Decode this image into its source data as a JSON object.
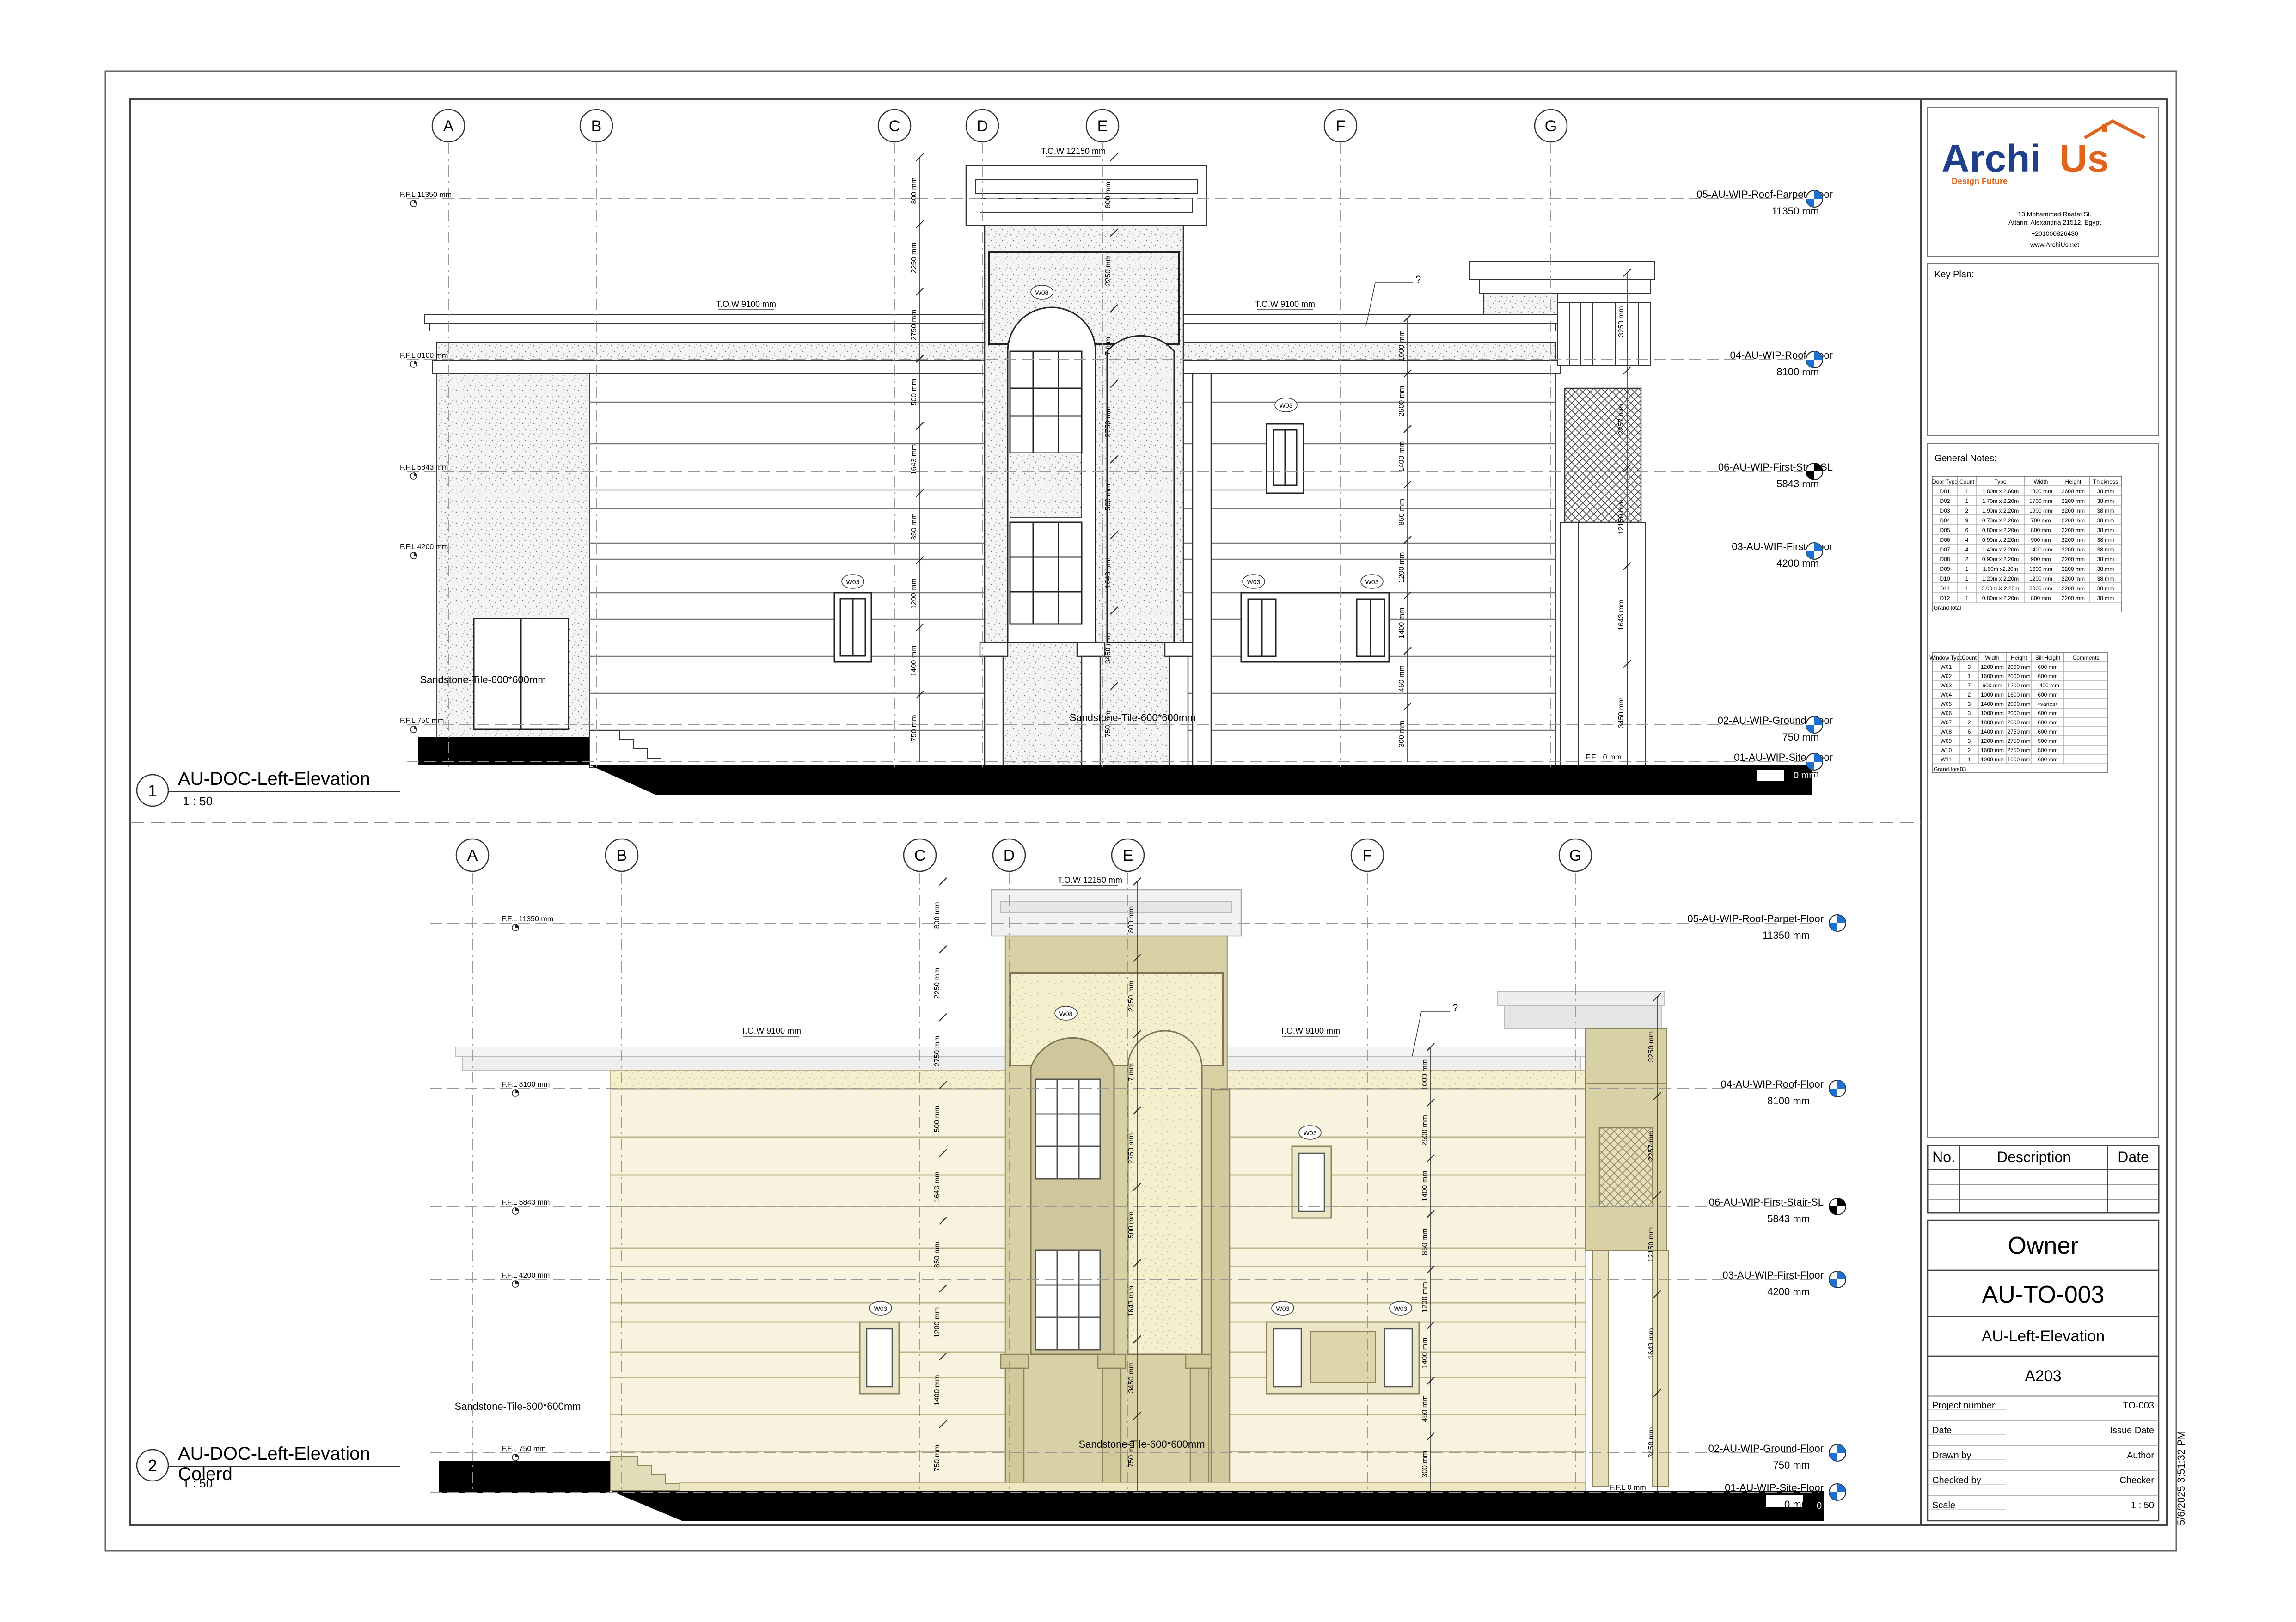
{
  "company": {
    "name_main": "Archi",
    "name_accent": "Us",
    "tagline": "Design Future",
    "address": [
      "13 Mohammad Raafat St.",
      "Attarin, Alexandria 21512, Egypt",
      "+201000826430",
      "www.ArchiUs.net"
    ]
  },
  "key_plan_label": "Key Plan:",
  "general_notes_label": "General Notes:",
  "door_schedule": {
    "headers": [
      "Door Type",
      "Count",
      "Type",
      "Width",
      "Height",
      "Thickness"
    ],
    "rows": [
      [
        "D01",
        "1",
        "1.80m x 2.60m",
        "1800 mm",
        "2600 mm",
        "38 mm"
      ],
      [
        "D02",
        "1",
        "1.70m x 2.20m",
        "1700 mm",
        "2200 mm",
        "38 mm"
      ],
      [
        "D03",
        "2",
        "1.90m x 2.20m",
        "1900 mm",
        "2200 mm",
        "38 mm"
      ],
      [
        "D04",
        "9",
        "0.70m x 2.20m",
        "700 mm",
        "2200 mm",
        "38 mm"
      ],
      [
        "D05",
        "6",
        "0.80m x 2.20m",
        "800 mm",
        "2200 mm",
        "38 mm"
      ],
      [
        "D06",
        "4",
        "0.90m x 2.20m",
        "900 mm",
        "2200 mm",
        "38 mm"
      ],
      [
        "D07",
        "4",
        "1.40m x 2.20m",
        "1400 mm",
        "2200 mm",
        "38 mm"
      ],
      [
        "D08",
        "2",
        "0.90m x 2.20m",
        "900 mm",
        "2200 mm",
        "38 mm"
      ],
      [
        "D09",
        "1",
        "1.60m x2.20m",
        "1600 mm",
        "2200 mm",
        "38 mm"
      ],
      [
        "D10",
        "1",
        "1.20m x 2.20m",
        "1200 mm",
        "2200 mm",
        "38 mm"
      ],
      [
        "D11",
        "1",
        "3.00m X 2.20m",
        "3000 mm",
        "2200 mm",
        "38 mm"
      ],
      [
        "D12",
        "1",
        "0.80m x 2.20m",
        "800 mm",
        "2200 mm",
        "38 mm"
      ]
    ],
    "footer": "Grand total"
  },
  "window_schedule": {
    "headers": [
      "Window Type",
      "Count",
      "Width",
      "Height",
      "Sill Height",
      "Comments"
    ],
    "rows": [
      [
        "W01",
        "3",
        "1200 mm",
        "2000 mm",
        "600 mm",
        ""
      ],
      [
        "W02",
        "1",
        "1600 mm",
        "2000 mm",
        "600 mm",
        ""
      ],
      [
        "W03",
        "7",
        "600 mm",
        "1200 mm",
        "1400 mm",
        ""
      ],
      [
        "W04",
        "2",
        "1000 mm",
        "1600 mm",
        "600 mm",
        ""
      ],
      [
        "W05",
        "3",
        "1400 mm",
        "2000 mm",
        "<varies>",
        ""
      ],
      [
        "W06",
        "3",
        "1000 mm",
        "2000 mm",
        "600 mm",
        ""
      ],
      [
        "W07",
        "2",
        "1800 mm",
        "2000 mm",
        "600 mm",
        ""
      ],
      [
        "W08",
        "6",
        "1400 mm",
        "2750 mm",
        "600 mm",
        ""
      ],
      [
        "W09",
        "3",
        "1200 mm",
        "2750 mm",
        "500 mm",
        ""
      ],
      [
        "W10",
        "2",
        "1600 mm",
        "2750 mm",
        "500 mm",
        ""
      ],
      [
        "W11",
        "1",
        "1000 mm",
        "1600 mm",
        "600 mm",
        ""
      ]
    ],
    "footer": [
      "Grand total",
      "33"
    ]
  },
  "revision_table": {
    "headers": [
      "No.",
      "Description",
      "Date"
    ]
  },
  "title_block": {
    "owner": "Owner",
    "sheet_code": "AU-TO-003",
    "sheet_name": "AU-Left-Elevation",
    "sheet_number": "A203",
    "fields": [
      [
        "Project number",
        "TO-003"
      ],
      [
        "Date",
        "Issue Date"
      ],
      [
        "Drawn by",
        "Author"
      ],
      [
        "Checked by",
        "Checker"
      ],
      [
        "Scale",
        "1 : 50"
      ]
    ],
    "timestamp": "5/6/2025 3:51:32 PM"
  },
  "views": [
    {
      "number": "1",
      "title": "AU-DOC-Left-Elevation",
      "title_line2": "",
      "scale": "1 : 50",
      "grids": [
        "A",
        "B",
        "C",
        "D",
        "E",
        "F",
        "G"
      ]
    },
    {
      "number": "2",
      "title": "AU-DOC-Left-Elevation",
      "title_line2": "Colerd",
      "scale": "1 : 50",
      "grids": [
        "A",
        "B",
        "C",
        "D",
        "E",
        "F",
        "G"
      ]
    }
  ],
  "levels": [
    {
      "name": "05-AU-WIP-Roof-Parpet-Floor",
      "elev": "11350 mm"
    },
    {
      "name": "04-AU-WIP-Roof-Floor",
      "elev": "8100 mm"
    },
    {
      "name": "06-AU-WIP-First-Stair-SL",
      "elev": "5843 mm"
    },
    {
      "name": "03-AU-WIP-First-Floor",
      "elev": "4200 mm"
    },
    {
      "name": "02-AU-WIP-Ground-Floor",
      "elev": "750 mm"
    },
    {
      "name": "01-AU-WIP-Site-Floor",
      "elev": "0 mm"
    }
  ],
  "ffl_tags": [
    "F.F.L 11350 mm",
    "F.F.L 8100 mm",
    "F.F.L 5843 mm",
    "F.F.L 4200 mm",
    "F.F.L 750 mm",
    "F.F.L 0 mm"
  ],
  "tow_tags": [
    "T.O.W 12150 mm",
    "T.O.W 9100 mm",
    "T.O.W 9100 mm"
  ],
  "material_tags": [
    "Sandstone-Tile-600*600mm",
    "Sandstone-Tile-600*600mm"
  ],
  "window_tags": [
    "W08",
    "W03",
    "W03",
    "W03",
    "W03"
  ],
  "misc_tags": [
    "?"
  ],
  "dimensions": {
    "left_chain": [
      "800 mm",
      "2250 mm",
      "2750 mm",
      "500 mm",
      "1643 mm",
      "850 mm",
      "1200 mm",
      "1400 mm",
      "750 mm"
    ],
    "mid_chain": [
      "800 mm",
      "2250 mm",
      "7 mm",
      "2750 mm",
      "500 mm",
      "1643 mm",
      "3450 mm",
      "750 mm"
    ],
    "right_chain": [
      "1000 mm",
      "2500 mm",
      "1400 mm",
      "850 mm",
      "1200 mm",
      "1400 mm",
      "450 mm",
      "300 mm"
    ],
    "stair_chain": [
      "3250 mm",
      "2257 mm",
      "12150 mm",
      "1643 mm",
      "3450 mm"
    ]
  },
  "colors": {
    "border": "#555555",
    "logo_blue": "#1e3f8a",
    "logo_orange": "#e2641c",
    "wall_plain": "#ffffff",
    "wall_colored": "#f6f2df",
    "tower_colored": "#d9d1a6",
    "ground": "#000000",
    "level_marker_blue": "#1d6fd0"
  }
}
